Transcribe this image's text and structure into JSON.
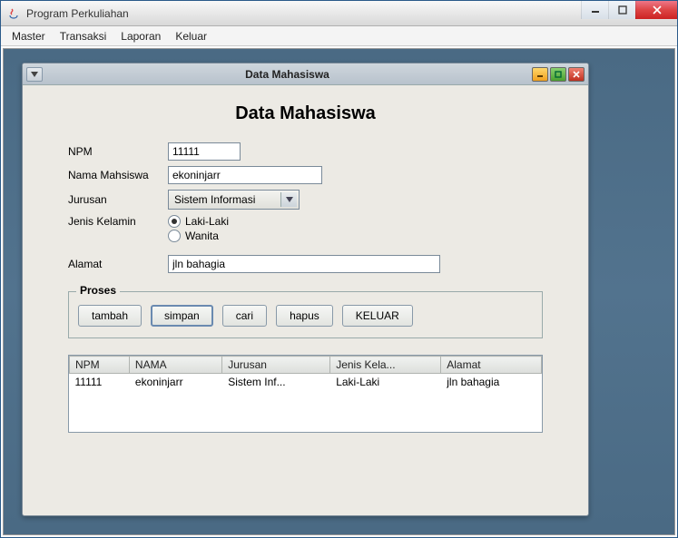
{
  "window": {
    "title": "Program Perkuliahan"
  },
  "menu": {
    "items": [
      "Master",
      "Transaksi",
      "Laporan",
      "Keluar"
    ]
  },
  "internal": {
    "title": "Data Mahasiswa"
  },
  "heading": "Data Mahasiswa",
  "labels": {
    "npm": "NPM",
    "nama": "Nama Mahsiswa",
    "jurusan": "Jurusan",
    "jenis_kelamin": "Jenis Kelamin",
    "alamat": "Alamat"
  },
  "fields": {
    "npm": "11111",
    "nama": "ekoninjarr",
    "jurusan": "Sistem Informasi",
    "alamat": "jln bahagia"
  },
  "radios": {
    "laki": "Laki-Laki",
    "wanita": "Wanita",
    "selected": "laki"
  },
  "proses": {
    "legend": "Proses",
    "tambah": "tambah",
    "simpan": "simpan",
    "cari": "cari",
    "hapus": "hapus",
    "keluar": "KELUAR"
  },
  "table": {
    "headers": [
      "NPM",
      "NAMA",
      "Jurusan",
      "Jenis Kela...",
      "Alamat"
    ],
    "rows": [
      [
        "11111",
        "ekoninjarr",
        "Sistem Inf...",
        "Laki-Laki",
        "jln bahagia"
      ]
    ]
  }
}
